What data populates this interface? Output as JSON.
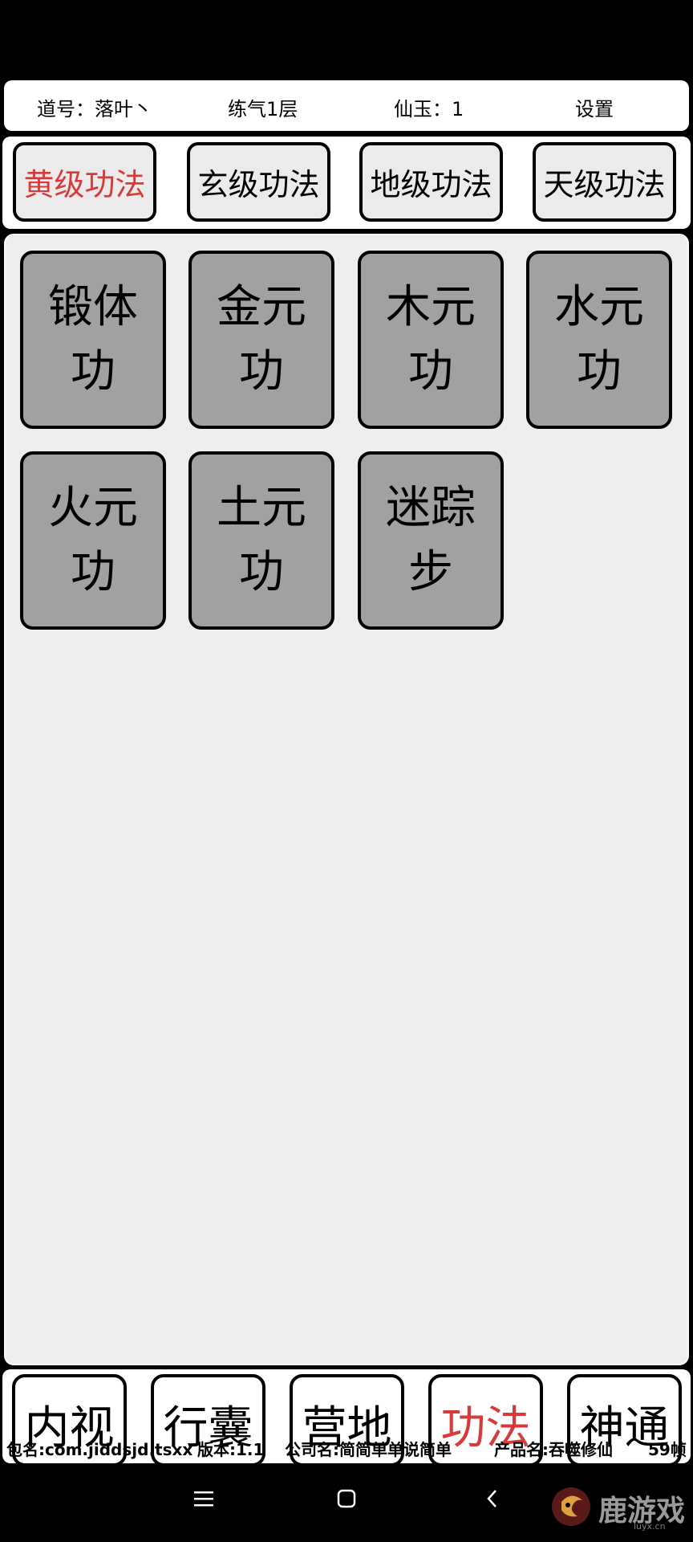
{
  "status_bar": {
    "dao_name": "道号：落叶丶",
    "realm": "练气1层",
    "jade": "仙玉：1",
    "settings": "设置"
  },
  "tabs": [
    {
      "label": "黄级功法",
      "active": true
    },
    {
      "label": "玄级功法",
      "active": false
    },
    {
      "label": "地级功法",
      "active": false
    },
    {
      "label": "天级功法",
      "active": false
    }
  ],
  "skills": [
    {
      "label": "锻体功"
    },
    {
      "label": "金元功"
    },
    {
      "label": "木元功"
    },
    {
      "label": "水元功"
    },
    {
      "label": "火元功"
    },
    {
      "label": "土元功"
    },
    {
      "label": "迷踪步"
    }
  ],
  "bottom_nav": [
    {
      "label": "内视",
      "active": false
    },
    {
      "label": "行囊",
      "active": false
    },
    {
      "label": "营地",
      "active": false
    },
    {
      "label": "功法",
      "active": true
    },
    {
      "label": "神通",
      "active": false
    }
  ],
  "footer": {
    "package": "包名:com.jiddsjd.tsxx",
    "version": "版本:1.1",
    "company": "公司名:简简单单说简单",
    "product": "产品名:吞噬修仙",
    "fps": "59帧"
  },
  "system_nav": {
    "menu_icon": "menu-icon",
    "home_icon": "home-icon",
    "back_icon": "back-icon"
  },
  "watermark": {
    "text": "鹿游戏",
    "url": "luyx.cn"
  },
  "colors": {
    "active_text": "#d83a3a",
    "skill_bg": "#a1a1a1",
    "panel_bg": "#ededed",
    "tab_bg": "#ebebeb"
  }
}
